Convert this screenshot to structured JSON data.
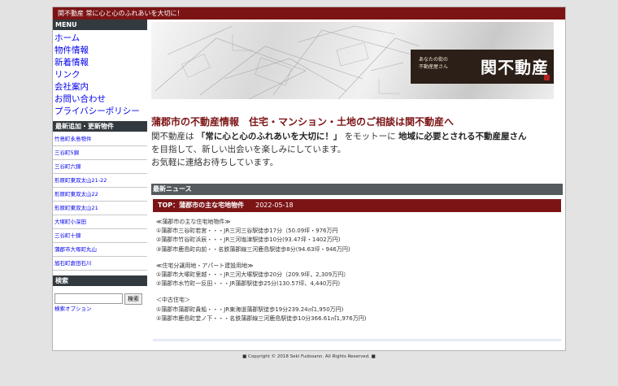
{
  "topbar": {
    "text": "関不動産 常に心と心のふれあいを大切に！"
  },
  "sidebar": {
    "menu_title": "MENU",
    "menu": [
      {
        "label": "ホーム"
      },
      {
        "label": "物件情報"
      },
      {
        "label": "新着情報"
      },
      {
        "label": "リンク"
      },
      {
        "label": "会社案内"
      },
      {
        "label": "お問い合わせ"
      },
      {
        "label": "プライバシーポリシー"
      }
    ],
    "new_title": "最新追加・更新物件",
    "new_items": [
      {
        "label": "竹島町永島物件"
      },
      {
        "label": "三谷町5錦"
      },
      {
        "label": "三谷町六錦"
      },
      {
        "label": "形原町東双太山21-22"
      },
      {
        "label": "形原町東双太山22"
      },
      {
        "label": "形原町東双太山21"
      },
      {
        "label": "大塚町小深田"
      },
      {
        "label": "三谷町十錦"
      },
      {
        "label": "蒲郡市大塚町丸山"
      },
      {
        "label": "旭石町倉田石川"
      }
    ],
    "search_title": "検索",
    "search_button": "検索",
    "search_option": "検索オプション"
  },
  "hero": {
    "tagline_1": "あなたの街の",
    "tagline_2": "不動産屋さん",
    "logo_text": "関不動産"
  },
  "main": {
    "heading": "蒲郡市の不動産情報　住宅・マンション・土地のご相談は関不動産へ",
    "intro_1a": "関不動産は",
    "intro_1b": "「常に心と心のふれあいを大切に！」",
    "intro_1c": "をモットーに",
    "intro_1d": "地域に必要とされる不動産屋さん",
    "intro_2": "を目指して、新しい出会いを楽しみにしています。",
    "intro_3": "お気軽に連絡お待ちしています。"
  },
  "news": {
    "header": "最新ニュース",
    "title": "TOP：蒲郡市の主な宅地物件",
    "date": "2022-05-18",
    "section1_title": "≪蒲郡市の主な住宅地物件≫",
    "section1": [
      "①蒲郡市三谷町若宮・・・JR三河三谷駅徒歩17分（50.09坪・976万円",
      "②蒲郡市竹谷町浜辰・・・JR三河塩津駅徒歩10分(93.47坪・1402万円)",
      "③蒲郡市鹿島町向前・・名鉄蒲郡線三河鹿島駅徒歩8分(94.63坪・946万円)"
    ],
    "section2_title": "≪住宅分譲用地・アパート建設用地≫",
    "section2": [
      "①蒲郡市大塚町里越・・・JR三河大塚駅徒歩20分（209.9坪，2,309万円）",
      "②蒲郡市水竹町一反田・・・JR蒲郡駅徒歩25分(130.57坪、4,440万円)"
    ],
    "section3_title": "＜中古住宅＞",
    "section3": [
      "①蒲郡市蒲郡町貴船・・・JR東海道蒲郡駅徒歩19分239.24㎡1,950万円)",
      "②蒲郡市鹿島町堂ノ下・・・名鉄蒲郡線三河鹿島駅徒歩10分366.61㎡1,976万円)"
    ]
  },
  "footer": {
    "text": "■ Copyright © 2018 Seki Fudosann. All Rights Reserved. ■"
  },
  "colors": {
    "accent": "#7c1416",
    "sidebar_header": "#333a3f",
    "link": "#0000ee",
    "page_bg": "#e3e3e3"
  }
}
